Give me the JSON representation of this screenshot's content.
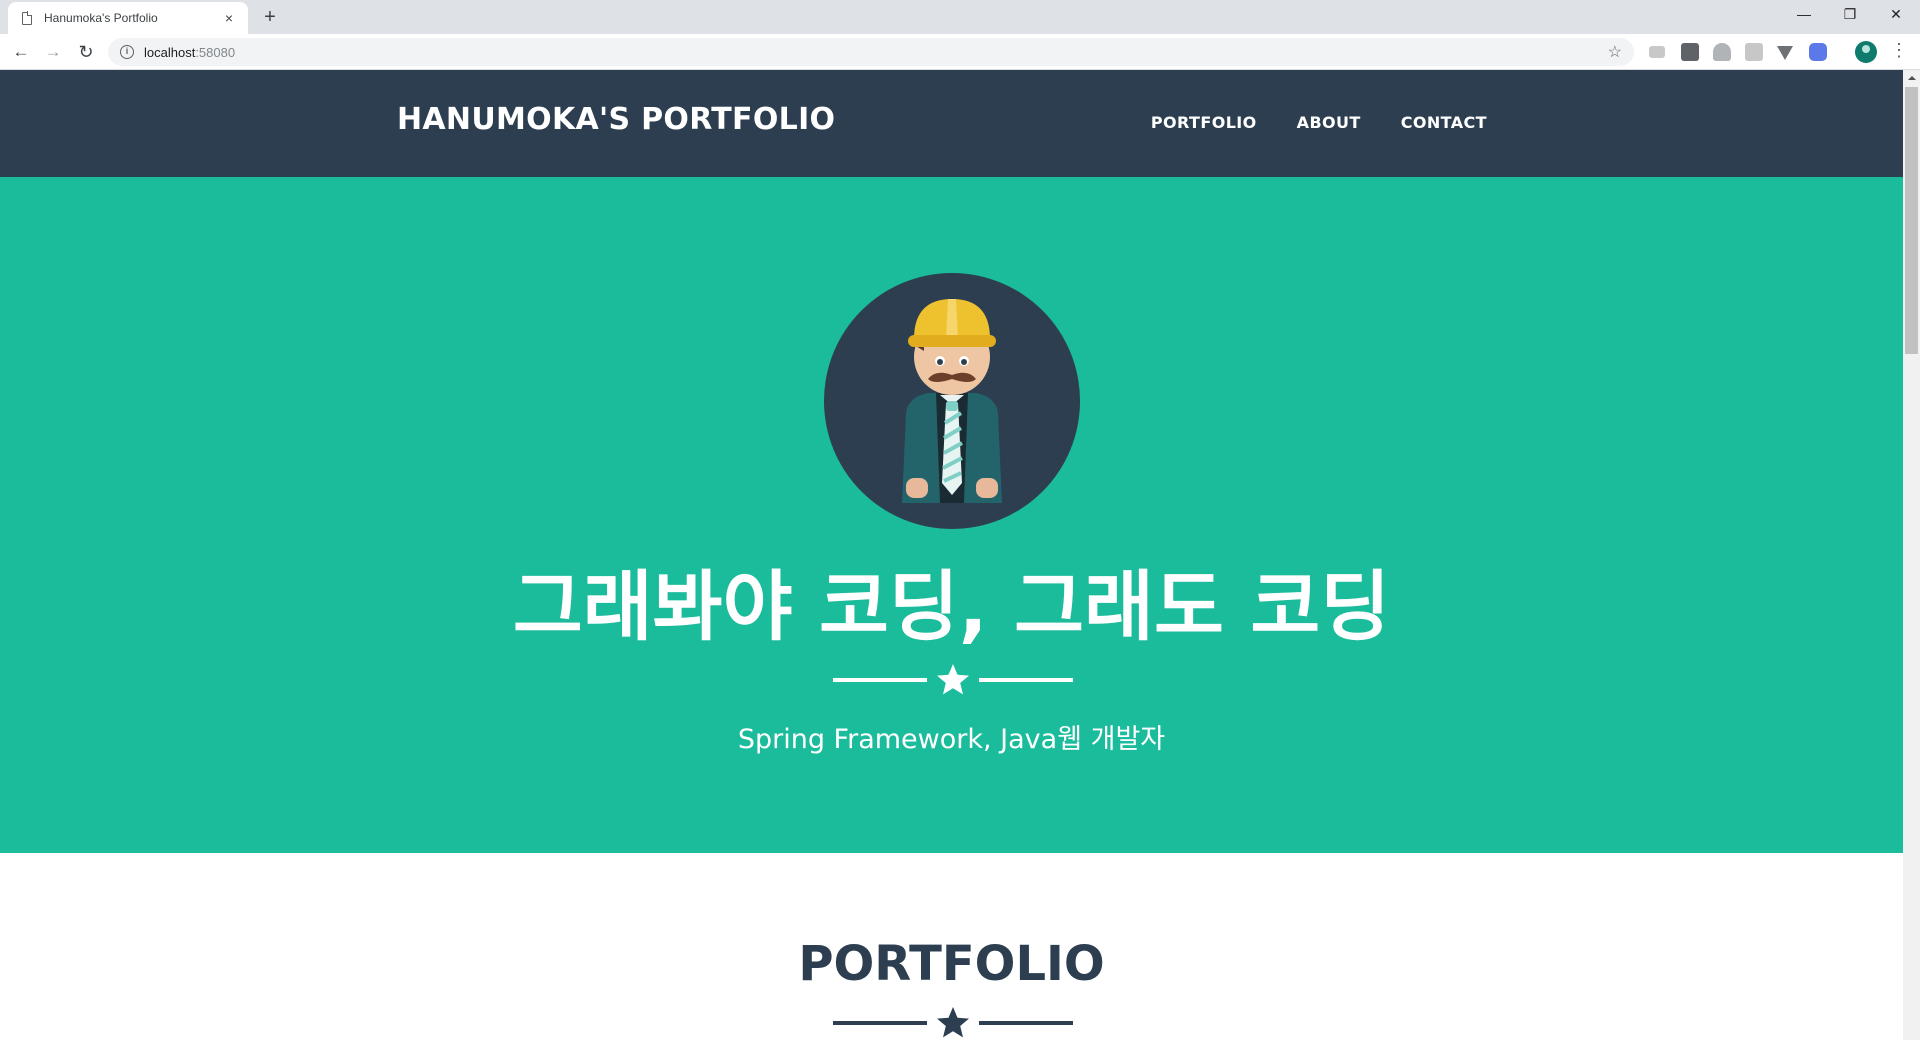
{
  "browser": {
    "tab_title": "Hanumoka's Portfolio",
    "tab_close": "×",
    "new_tab": "+",
    "url_host": "localhost",
    "url_port": ":58080",
    "back": "←",
    "forward": "→",
    "reload": "↻",
    "bookmark_star": "☆",
    "menu": "⋮",
    "window": {
      "minimize": "—",
      "maximize": "❐",
      "close": "✕"
    }
  },
  "site": {
    "brand": "HANUMOKA'S PORTFOLIO",
    "nav": [
      "PORTFOLIO",
      "ABOUT",
      "CONTACT"
    ],
    "hero": {
      "title": "그래봐야 코딩, 그래도 코딩",
      "subtitle": "Spring Framework, Java웹 개발자"
    },
    "portfolio_heading": "PORTFOLIO"
  },
  "colors": {
    "navbar": "#2c3e50",
    "hero": "#1abc9c",
    "text_light": "#ffffff",
    "heading_dark": "#2c3e50"
  },
  "icons": {
    "hero_avatar": "developer-avatar-icon",
    "divider": "star-icon"
  }
}
